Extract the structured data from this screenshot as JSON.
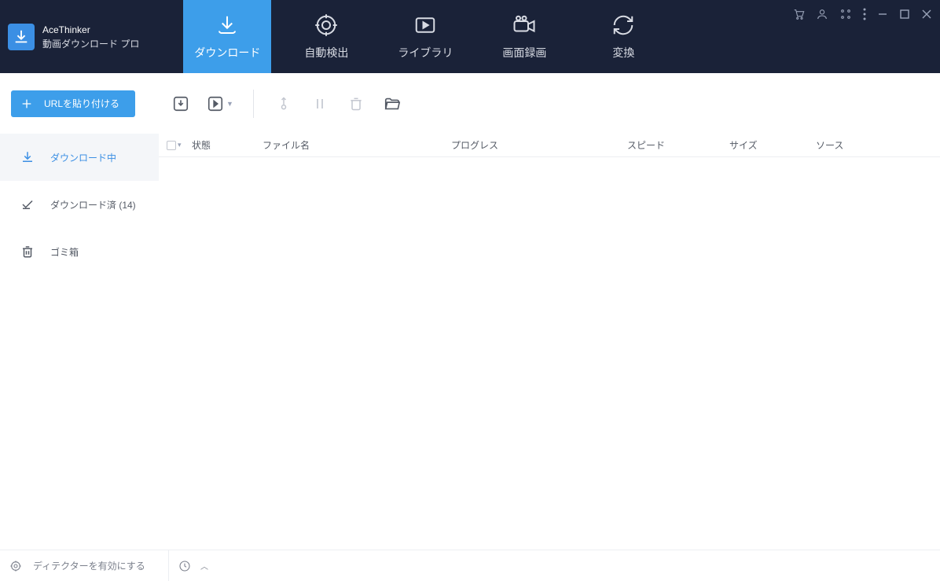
{
  "app": {
    "brand": "AceThinker",
    "subtitle": "動画ダウンロード プロ"
  },
  "nav": {
    "tabs": [
      {
        "label": "ダウンロード",
        "active": true
      },
      {
        "label": "自動検出",
        "active": false
      },
      {
        "label": "ライブラリ",
        "active": false
      },
      {
        "label": "画面録画",
        "active": false
      },
      {
        "label": "変換",
        "active": false
      }
    ]
  },
  "toolbar": {
    "paste_label": "URLを貼り付ける"
  },
  "sidebar": {
    "items": [
      {
        "label": "ダウンロード中",
        "active": true
      },
      {
        "label": "ダウンロード済 (14)",
        "active": false
      },
      {
        "label": "ゴミ箱",
        "active": false
      }
    ]
  },
  "columns": {
    "status": "状態",
    "filename": "ファイル名",
    "progress": "プログレス",
    "speed": "スピード",
    "size": "サイズ",
    "source": "ソース"
  },
  "statusbar": {
    "detector": "ディテクターを有効にする"
  }
}
